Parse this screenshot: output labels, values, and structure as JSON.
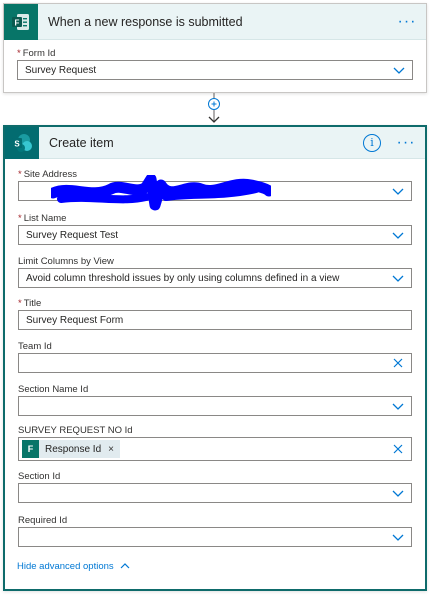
{
  "trigger": {
    "title": "When a new response is submitted",
    "form_id_label": "Form Id",
    "form_id_value": "Survey Request"
  },
  "action": {
    "title": "Create item",
    "fields": {
      "site_address": {
        "label": "Site Address",
        "value": ""
      },
      "list_name": {
        "label": "List Name",
        "value": "Survey Request Test"
      },
      "limit_columns": {
        "label": "Limit Columns by View",
        "value": "Avoid column threshold issues by only using columns defined in a view"
      },
      "title": {
        "label": "Title",
        "value": "Survey Request Form"
      },
      "team_id": {
        "label": "Team Id",
        "value": ""
      },
      "section_name_id": {
        "label": "Section Name Id",
        "value": ""
      },
      "survey_request_no_id": {
        "label": "SURVEY REQUEST NO Id",
        "token": "Response Id"
      },
      "section_id": {
        "label": "Section Id",
        "value": ""
      },
      "required_id": {
        "label": "Required Id",
        "value": ""
      }
    },
    "advanced_toggle": "Hide advanced options"
  },
  "colors": {
    "forms_green": "#077568",
    "sharepoint_teal": "#036c70",
    "accent_blue": "#0078d4",
    "header_bg": "#eaf4f5",
    "selected_border": "#0e6b6b"
  },
  "icons": [
    "forms-icon",
    "sharepoint-icon",
    "more-options-icon",
    "info-icon",
    "chevron-down-icon",
    "clear-icon",
    "add-step-icon",
    "chevron-up-icon"
  ]
}
